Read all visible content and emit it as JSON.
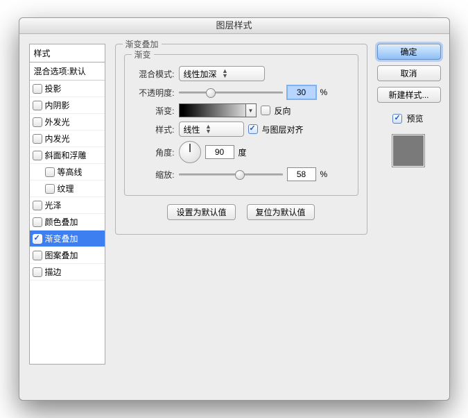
{
  "window": {
    "title": "图层样式"
  },
  "sidebar": {
    "header": "样式",
    "subheader": "混合选项:默认",
    "items": [
      {
        "label": "投影",
        "checked": false,
        "selected": false,
        "indent": 0
      },
      {
        "label": "内阴影",
        "checked": false,
        "selected": false,
        "indent": 0
      },
      {
        "label": "外发光",
        "checked": false,
        "selected": false,
        "indent": 0
      },
      {
        "label": "内发光",
        "checked": false,
        "selected": false,
        "indent": 0
      },
      {
        "label": "斜面和浮雕",
        "checked": false,
        "selected": false,
        "indent": 0
      },
      {
        "label": "等高线",
        "checked": false,
        "selected": false,
        "indent": 1
      },
      {
        "label": "纹理",
        "checked": false,
        "selected": false,
        "indent": 1
      },
      {
        "label": "光泽",
        "checked": false,
        "selected": false,
        "indent": 0
      },
      {
        "label": "颜色叠加",
        "checked": false,
        "selected": false,
        "indent": 0
      },
      {
        "label": "渐变叠加",
        "checked": true,
        "selected": true,
        "indent": 0
      },
      {
        "label": "图案叠加",
        "checked": false,
        "selected": false,
        "indent": 0
      },
      {
        "label": "描边",
        "checked": false,
        "selected": false,
        "indent": 0
      }
    ]
  },
  "panel": {
    "group_title": "渐变叠加",
    "inner_title": "渐变",
    "blend_mode": {
      "label": "混合模式:",
      "value": "线性加深"
    },
    "opacity": {
      "label": "不透明度:",
      "value": "30",
      "unit": "%",
      "percent": 30
    },
    "gradient": {
      "label": "渐变:",
      "reverse_label": "反向",
      "reverse": false
    },
    "style": {
      "label": "样式:",
      "value": "线性",
      "align_label": "与图层对齐",
      "align": true
    },
    "angle": {
      "label": "角度:",
      "value": "90",
      "unit": "度"
    },
    "scale": {
      "label": "缩放:",
      "value": "58",
      "unit": "%",
      "percent": 58
    },
    "buttons": {
      "set_default": "设置为默认值",
      "reset_default": "复位为默认值"
    }
  },
  "actions": {
    "ok": "确定",
    "cancel": "取消",
    "new_style": "新建样式...",
    "preview_label": "预览",
    "preview": true
  }
}
